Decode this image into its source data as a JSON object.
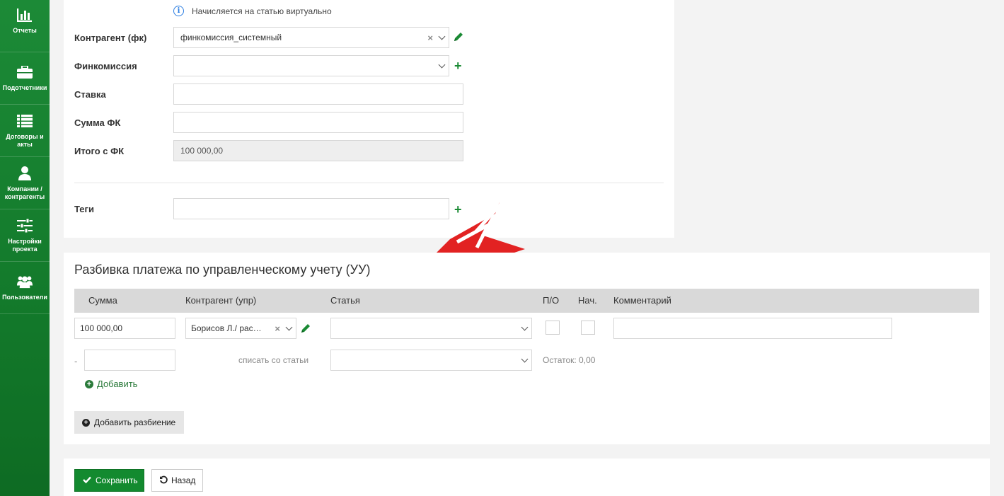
{
  "sidebar": {
    "items": [
      {
        "label": "Отчеты",
        "icon": "bar-chart-icon"
      },
      {
        "label": "Подотчетники",
        "icon": "briefcase-icon"
      },
      {
        "label": "Договоры и акты",
        "icon": "list-icon"
      },
      {
        "label": "Компании / контрагенты",
        "icon": "user-icon"
      },
      {
        "label": "Настройки проекта",
        "icon": "sliders-icon"
      },
      {
        "label": "Пользователи",
        "icon": "users-icon"
      }
    ]
  },
  "form": {
    "info_text": "Начисляется на статью виртуально",
    "counterparty_fk": {
      "label": "Контрагент (фк)",
      "value": "финкомиссия_системный"
    },
    "fincommission": {
      "label": "Финкомиссия",
      "value": ""
    },
    "rate": {
      "label": "Ставка",
      "value": ""
    },
    "sum_fk": {
      "label": "Сумма ФК",
      "value": ""
    },
    "total_fk": {
      "label": "Итого с ФК",
      "value": "100 000,00"
    },
    "tags": {
      "label": "Теги",
      "value": ""
    }
  },
  "breakdown": {
    "title": "Разбивка платежа по управленческому учету (УУ)",
    "columns": [
      "Сумма",
      "Контрагент (упр)",
      "Статья",
      "П/О",
      "Нач.",
      "Комментарий"
    ],
    "row": {
      "amount": "100 000,00",
      "counterparty": "Борисов Л./ рас…",
      "article": "",
      "comment": ""
    },
    "writeoff": {
      "minus": "-",
      "amount": "",
      "label": "списать со статьи",
      "article": "",
      "remainder": "Остаток: 0,00"
    },
    "add_label": "Добавить",
    "add_split_label": "Добавить разбиение"
  },
  "actions": {
    "save_label": "Сохранить",
    "back_label": "Назад"
  },
  "colors": {
    "sidebar": "#137a2b",
    "accent": "#1a8a34",
    "arrow": "#e02020"
  }
}
